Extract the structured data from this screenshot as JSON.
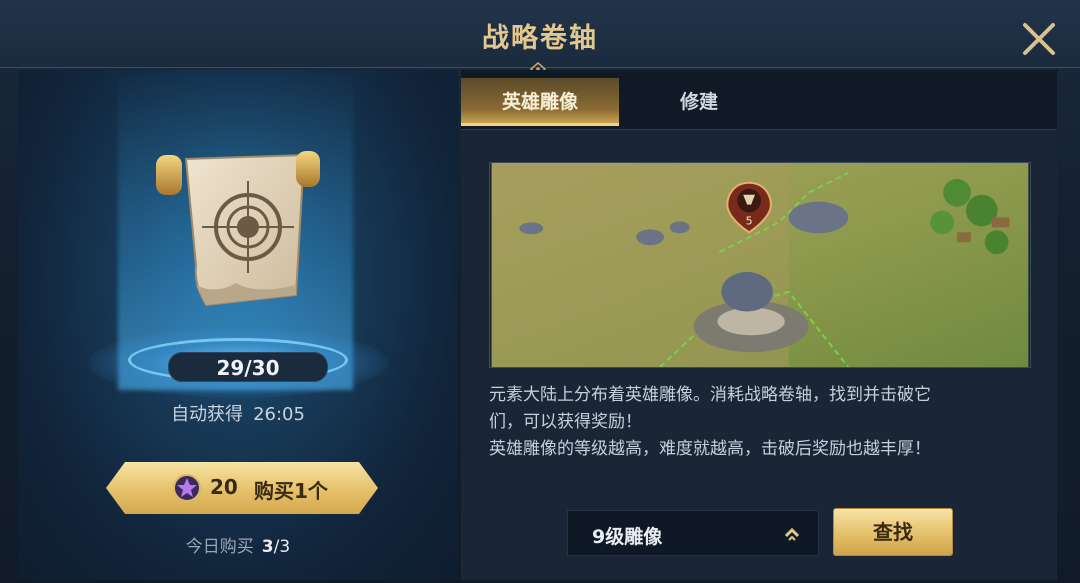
{
  "dialog": {
    "title": "战略卷轴"
  },
  "left": {
    "item_count": "29/30",
    "auto_label": "自动获得",
    "auto_timer": "26:05",
    "buy": {
      "price": "20",
      "label": "购买1个"
    },
    "today": {
      "label": "今日购买",
      "used": "3",
      "total": "/3"
    }
  },
  "tabs": [
    {
      "label": "英雄雕像",
      "active": true
    },
    {
      "label": "修建",
      "active": false
    }
  ],
  "map": {
    "marker_level": "5"
  },
  "description": {
    "line1": "元素大陆上分布着英雄雕像。消耗战略卷轴，找到并击破它",
    "line2": "们，可以获得奖励！",
    "line3": "英雄雕像的等级越高，难度就越高，击破后奖励也越丰厚！"
  },
  "controls": {
    "level_select_value": "9级雕像",
    "find_label": "查找"
  },
  "colors": {
    "accent_gold": "#e7c46e",
    "title_gold": "#e2c78e",
    "glow_blue": "#5fb8f0"
  },
  "icons": {
    "close": "close-icon",
    "gem": "purple-gem-icon",
    "chevron": "chevron-up-icon",
    "scroll": "strategy-scroll-icon",
    "marker": "statue-marker-icon"
  }
}
